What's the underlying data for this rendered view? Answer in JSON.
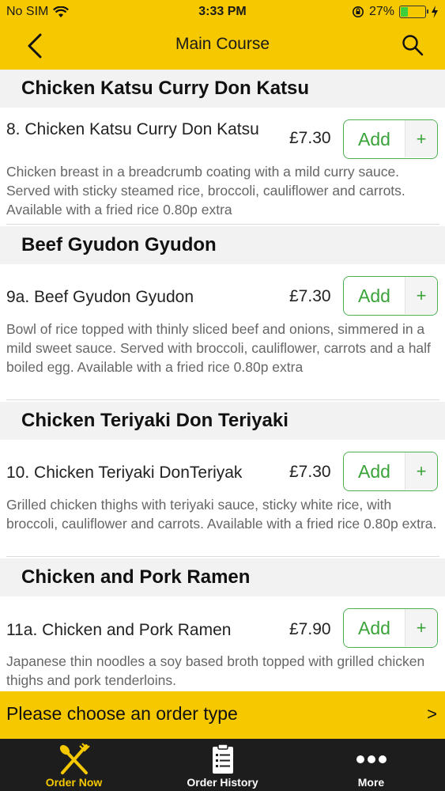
{
  "status_bar": {
    "carrier": "No SIM",
    "time": "3:33 PM",
    "battery": "27%",
    "battery_level": 0.27
  },
  "nav": {
    "title": "Main Course"
  },
  "sections": [
    {
      "header": "Chicken Katsu Curry Don Katsu",
      "item": {
        "name": "8. Chicken Katsu Curry Don Katsu",
        "price": "£7.30",
        "add_label": "Add",
        "plus": "+",
        "description": "Chicken breast in a breadcrumb coating with a mild curry sauce. Served with sticky steamed rice, broccoli, cauliflower and carrots. Available with a fried rice 0.80p extra"
      }
    },
    {
      "header": "Beef Gyudon Gyudon",
      "item": {
        "name": "9a. Beef Gyudon Gyudon",
        "price": "£7.30",
        "add_label": "Add",
        "plus": "+",
        "description": "Bowl of rice topped with thinly sliced beef and onions, simmered in a mild sweet sauce. Served with broccoli, cauliflower, carrots and a half boiled egg. Available with a fried rice 0.80p extra"
      }
    },
    {
      "header": "Chicken Teriyaki Don Teriyaki",
      "item": {
        "name": "10. Chicken Teriyaki DonTeriyak",
        "price": "£7.30",
        "add_label": "Add",
        "plus": "+",
        "description": "Grilled chicken thighs with teriyaki sauce, sticky white rice, with broccoli, cauliflower and carrots. Available with a fried rice 0.80p extra."
      }
    },
    {
      "header": "Chicken and Pork Ramen",
      "item": {
        "name": "11a. Chicken and Pork Ramen",
        "price": "£7.90",
        "add_label": "Add",
        "plus": "+",
        "description": "Japanese thin noodles a soy based broth topped with grilled chicken thighs and pork tenderloins."
      }
    }
  ],
  "order_bar": {
    "text": "Please choose an order type",
    "chevron": ">"
  },
  "tabs": [
    {
      "label": "Order Now",
      "icon": "fork-knife-icon",
      "color": "#f5c800"
    },
    {
      "label": "Order History",
      "icon": "clipboard-icon",
      "color": "#ffffff"
    },
    {
      "label": "More",
      "icon": "more-dots-icon",
      "color": "#ffffff"
    }
  ],
  "colors": {
    "brand_yellow": "#f5c800",
    "add_green": "#3aa33a",
    "tabbar_bg": "#1d1d1d"
  }
}
